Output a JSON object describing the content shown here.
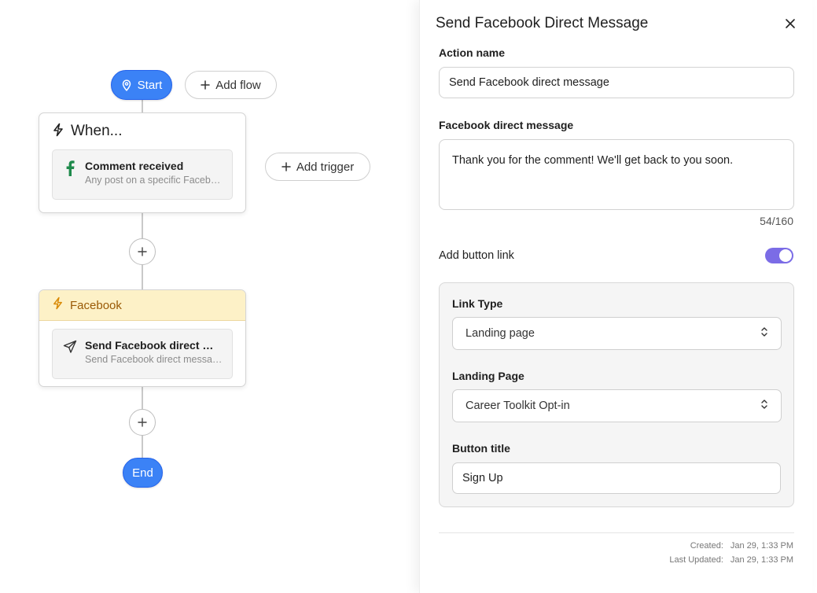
{
  "flow": {
    "start_label": "Start",
    "add_flow_label": "Add flow",
    "add_trigger_label": "Add trigger",
    "end_label": "End",
    "trigger_card": {
      "title": "When...",
      "item_title": "Comment received",
      "item_subtitle": "Any post on a specific Facebook page"
    },
    "action_card": {
      "title": "Facebook",
      "item_title": "Send Facebook direct message",
      "item_subtitle": "Send Facebook direct message to commenter"
    }
  },
  "panel": {
    "title": "Send Facebook Direct Message",
    "action_name_label": "Action name",
    "action_name_value": "Send Facebook direct message",
    "message_label": "Facebook direct message",
    "message_value": "Thank you for the comment! We'll get back to you soon.",
    "char_counter": "54/160",
    "add_button_link_label": "Add button link",
    "add_button_link_enabled": true,
    "link_type_label": "Link Type",
    "link_type_value": "Landing page",
    "landing_page_label": "Landing Page",
    "landing_page_value": "Career Toolkit Opt-in",
    "button_title_label": "Button title",
    "button_title_value": "Sign Up",
    "created_label": "Created:",
    "created_value": "Jan 29, 1:33 PM",
    "updated_label": "Last Updated:",
    "updated_value": "Jan 29, 1:33 PM"
  },
  "colors": {
    "accent_blue": "#3b82f6",
    "toggle_purple": "#7b6ce6",
    "facebook_green": "#1f8a4c",
    "action_header_yellow": "#fdf1c7"
  },
  "icons": {
    "start": "map-pin-icon",
    "add": "plus-icon",
    "trigger": "lightning-icon",
    "facebook": "facebook-icon",
    "send": "paper-plane-icon",
    "close": "close-icon",
    "select": "chevron-up-down-icon"
  }
}
